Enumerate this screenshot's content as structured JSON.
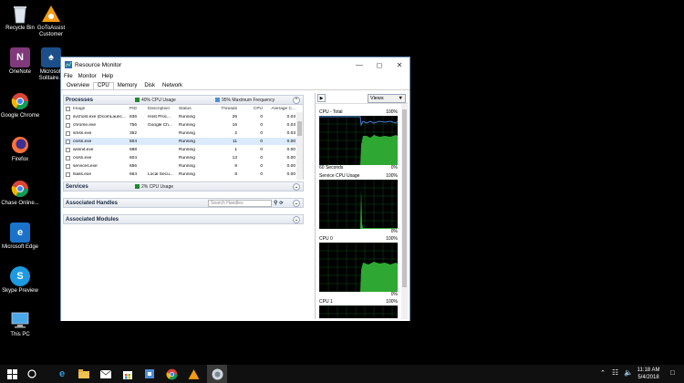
{
  "desktop": {
    "icons": [
      {
        "label": "Recycle Bin"
      },
      {
        "label": "GoToAssist Customer"
      },
      {
        "label": "OneNote"
      },
      {
        "label": "Microsoft Solitaire..."
      },
      {
        "label": "Google Chrome"
      },
      {
        "label": "Firefox"
      },
      {
        "label": "Chase Online..."
      },
      {
        "label": "Microsoft Edge"
      },
      {
        "label": "Skype Preview"
      },
      {
        "label": "This PC"
      }
    ]
  },
  "window": {
    "title": "Resource Monitor",
    "menu": [
      "File",
      "Monitor",
      "Help"
    ],
    "tabs": [
      "Overview",
      "CPU",
      "Memory",
      "Disk",
      "Network"
    ],
    "active_tab": "CPU"
  },
  "processes": {
    "title": "Processes",
    "cpu_usage": "40% CPU Usage",
    "max_freq": "95% Maximum Frequency",
    "columns": [
      "Image",
      "PID",
      "Description",
      "Status",
      "Threads",
      "CPU",
      "Average C..."
    ],
    "rows": [
      [
        "svchost.exe (DcomLaunc...",
        "836",
        "Host Proc...",
        "Running",
        "26",
        "0",
        "0.03"
      ],
      [
        "chrome.exe",
        "756",
        "Google Ch...",
        "Running",
        "16",
        "0",
        "0.03"
      ],
      [
        "smss.exe",
        "352",
        "",
        "Running",
        "2",
        "0",
        "0.03"
      ],
      [
        "csrss.exe",
        "504",
        "",
        "Running",
        "11",
        "0",
        "0.00"
      ],
      [
        "wininit.exe",
        "588",
        "",
        "Running",
        "1",
        "0",
        "0.00"
      ],
      [
        "csrss.exe",
        "604",
        "",
        "Running",
        "13",
        "0",
        "0.00"
      ],
      [
        "services.exe",
        "656",
        "",
        "Running",
        "9",
        "0",
        "0.00"
      ],
      [
        "lsass.exe",
        "664",
        "Local Secu...",
        "Running",
        "8",
        "0",
        "0.00"
      ]
    ]
  },
  "services": {
    "title": "Services",
    "cpu_usage": "2% CPU Usage"
  },
  "handles": {
    "title": "Associated Handles",
    "search_placeholder": "Search Handles"
  },
  "modules": {
    "title": "Associated Modules"
  },
  "right_pane": {
    "views_label": "Views",
    "graphs": [
      {
        "title": "CPU - Total",
        "max": "100%",
        "foot_left": "60 Seconds",
        "foot_right": "0%"
      },
      {
        "title": "Service CPU Usage",
        "max": "100%",
        "foot_left": "",
        "foot_right": "0%"
      },
      {
        "title": "CPU 0",
        "max": "100%",
        "foot_left": "",
        "foot_right": "0%"
      },
      {
        "title": "CPU 1",
        "max": "100%",
        "foot_left": "",
        "foot_right": ""
      }
    ]
  },
  "taskbar": {
    "time": "11:18 AM",
    "date": "5/4/2018"
  }
}
